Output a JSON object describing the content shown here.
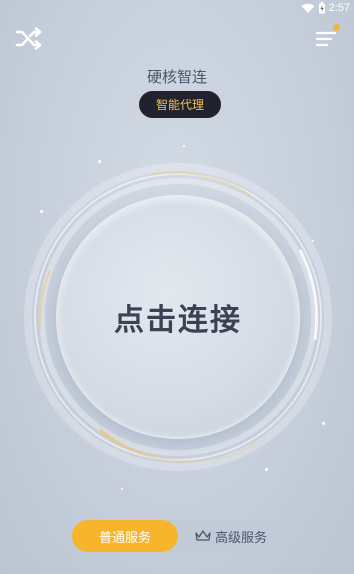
{
  "status_bar": {
    "time": "2:57"
  },
  "header": {
    "title": "硬核智连",
    "mode_label": "智能代理"
  },
  "main": {
    "connect_label": "点击连接"
  },
  "services": {
    "basic_label": "普通服务",
    "premium_label": "高级服务"
  },
  "icons": {
    "left": "shuffle-icon",
    "right": "menu-icon",
    "premium": "crown-icon"
  },
  "colors": {
    "accent": "#f7b52d",
    "pill_bg": "#20232d",
    "pill_text": "#f3c155"
  }
}
